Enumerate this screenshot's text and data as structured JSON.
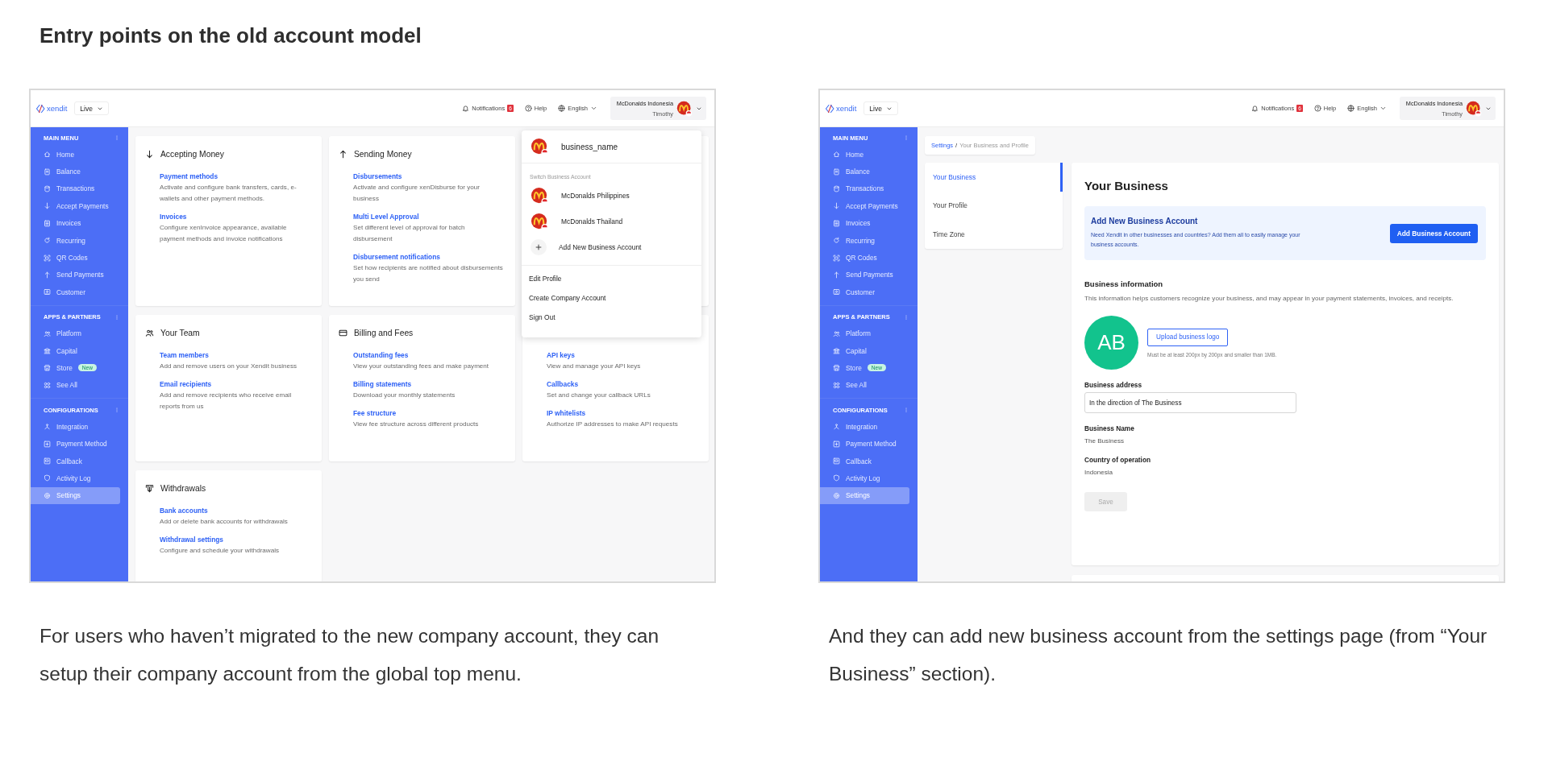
{
  "heading": "Entry points on the old account model",
  "screens": [
    {
      "kind": "dashboard",
      "topbar": {
        "brand": "xendit",
        "environment": "Live",
        "notifications": "Notifications",
        "notification_count": "6",
        "help": "Help",
        "language": "English",
        "account_name": "McDonalds Indonesia",
        "user": "Timothy"
      },
      "sidebar": [
        {
          "title": "MAIN MENU",
          "items": [
            {
              "label": "Home",
              "selected": false
            },
            {
              "label": "Balance",
              "selected": false
            },
            {
              "label": "Transactions",
              "selected": false
            },
            {
              "label": "Accept Payments",
              "selected": false
            },
            {
              "label": "Invoices",
              "selected": false
            },
            {
              "label": "Recurring",
              "selected": false
            },
            {
              "label": "QR Codes",
              "selected": false
            },
            {
              "label": "Send Payments",
              "selected": false
            },
            {
              "label": "Customer",
              "selected": false
            }
          ]
        },
        {
          "title": "APPS & PARTNERS",
          "items": [
            {
              "label": "Platform",
              "selected": false
            },
            {
              "label": "Capital",
              "selected": false
            },
            {
              "label": "Store",
              "selected": false,
              "badge": "New"
            },
            {
              "label": "See All",
              "selected": false
            }
          ]
        },
        {
          "title": "CONFIGURATIONS",
          "items": [
            {
              "label": "Integration",
              "selected": false
            },
            {
              "label": "Payment Method",
              "selected": false
            },
            {
              "label": "Callback",
              "selected": false
            },
            {
              "label": "Activity Log",
              "selected": false
            },
            {
              "label": "Settings",
              "selected": true
            }
          ]
        }
      ],
      "cards": [
        {
          "kind": "section",
          "title": "Accepting Money",
          "links": [
            {
              "label": "Payment methods",
              "desc": "Activate and configure bank transfers, cards, e-wallets and other payment methods."
            },
            {
              "label": "Invoices",
              "desc": "Configure xenInvoice appearance, available payment methods and invoice notifications"
            }
          ]
        },
        {
          "kind": "section",
          "title": "Sending Money",
          "links": [
            {
              "label": "Disbursements",
              "desc": "Activate and configure xenDisburse for your business"
            },
            {
              "label": "Multi Level Approval",
              "desc": "Set different level of approval for batch disbursement"
            },
            {
              "label": "Disbursement notifications",
              "desc": "Set how recipients are notified about disbursements you send"
            }
          ]
        },
        {
          "kind": "covered"
        },
        {
          "kind": "section",
          "title": "Your Team",
          "links": [
            {
              "label": "Team members",
              "desc": "Add and remove users on your Xendit business"
            },
            {
              "label": "Email recipients",
              "desc": "Add and remove recipients who receive email reports from us"
            }
          ]
        },
        {
          "kind": "section",
          "title": "Billing and Fees",
          "links": [
            {
              "label": "Outstanding fees",
              "desc": "View your outstanding fees and make payment"
            },
            {
              "label": "Billing statements",
              "desc": "Download your monthly statements"
            },
            {
              "label": "Fee structure",
              "desc": "View fee structure across different products"
            }
          ]
        },
        {
          "kind": "section",
          "links": [
            {
              "label": "API keys",
              "desc": "View and manage your API keys"
            },
            {
              "label": "Callbacks",
              "desc": "Set and change your callback URLs"
            },
            {
              "label": "IP whitelists",
              "desc": "Authorize IP addresses to make API requests"
            }
          ]
        },
        {
          "kind": "section",
          "title": "Withdrawals",
          "links": [
            {
              "label": "Bank accounts",
              "desc": "Add or delete bank accounts for withdrawals"
            },
            {
              "label": "Withdrawal settings",
              "desc": "Configure and schedule your withdrawals"
            }
          ]
        }
      ],
      "account_menu": {
        "business_name": "business_name",
        "switch_label": "Switch Business Account",
        "accounts": [
          "McDonalds Philippines",
          "McDonalds Thailand"
        ],
        "add_label": "Add New Business Account",
        "actions": [
          "Edit Profile",
          "Create Company Account",
          "Sign Out"
        ]
      }
    },
    {
      "kind": "settings",
      "topbar": {
        "brand": "xendit",
        "environment": "Live",
        "notifications": "Notifications",
        "notification_count": "6",
        "help": "Help",
        "language": "English",
        "account_name": "McDonalds Indonesia",
        "user": "Timothy"
      },
      "sidebar": [
        {
          "title": "MAIN MENU",
          "items": [
            {
              "label": "Home",
              "selected": false
            },
            {
              "label": "Balance",
              "selected": false
            },
            {
              "label": "Transactions",
              "selected": false
            },
            {
              "label": "Accept Payments",
              "selected": false
            },
            {
              "label": "Invoices",
              "selected": false
            },
            {
              "label": "Recurring",
              "selected": false
            },
            {
              "label": "QR Codes",
              "selected": false
            },
            {
              "label": "Send Payments",
              "selected": false
            },
            {
              "label": "Customer",
              "selected": false
            }
          ]
        },
        {
          "title": "APPS & PARTNERS",
          "items": [
            {
              "label": "Platform",
              "selected": false
            },
            {
              "label": "Capital",
              "selected": false
            },
            {
              "label": "Store",
              "selected": false,
              "badge": "New"
            },
            {
              "label": "See All",
              "selected": false
            }
          ]
        },
        {
          "title": "CONFIGURATIONS",
          "items": [
            {
              "label": "Integration",
              "selected": false
            },
            {
              "label": "Payment Method",
              "selected": false
            },
            {
              "label": "Callback",
              "selected": false
            },
            {
              "label": "Activity Log",
              "selected": false
            },
            {
              "label": "Settings",
              "selected": true
            }
          ]
        }
      ],
      "breadcrumb": {
        "parent": "Settings",
        "separator": "/",
        "current": "Your Business and Profile"
      },
      "settings_tabs": [
        {
          "label": "Your Business",
          "selected": true
        },
        {
          "label": "Your Profile",
          "selected": false
        },
        {
          "label": "Time Zone",
          "selected": false
        }
      ],
      "business_panel": {
        "title": "Your Business",
        "banner": {
          "title": "Add New Business Account",
          "text": "Need Xendit in other businesses and countries? Add them all to easily manage your business accounts.",
          "button": "Add Business Account"
        },
        "info_title": "Business information",
        "info_text": "This information helps customers recognize your business, and may appear in your payment statements, invoices, and receipts.",
        "avatar_initials": "AB",
        "upload_button": "Upload business logo",
        "upload_hint": "Must be at least 200px by 200px and smaller than 1MB.",
        "fields": [
          {
            "kind": "input",
            "label": "Business address",
            "value": "In the direction of The Business"
          },
          {
            "kind": "text",
            "label": "Business Name",
            "value": "The Business"
          },
          {
            "kind": "text",
            "label": "Country of operation",
            "value": "Indonesia"
          }
        ],
        "save_button": {
          "label": "Save",
          "disabled": true
        }
      }
    }
  ],
  "captions": [
    "For users who haven’t migrated to the new company account, they can setup their company account from the global top menu.",
    "And they can add new business account from the settings page (from “Your Business” section)."
  ]
}
